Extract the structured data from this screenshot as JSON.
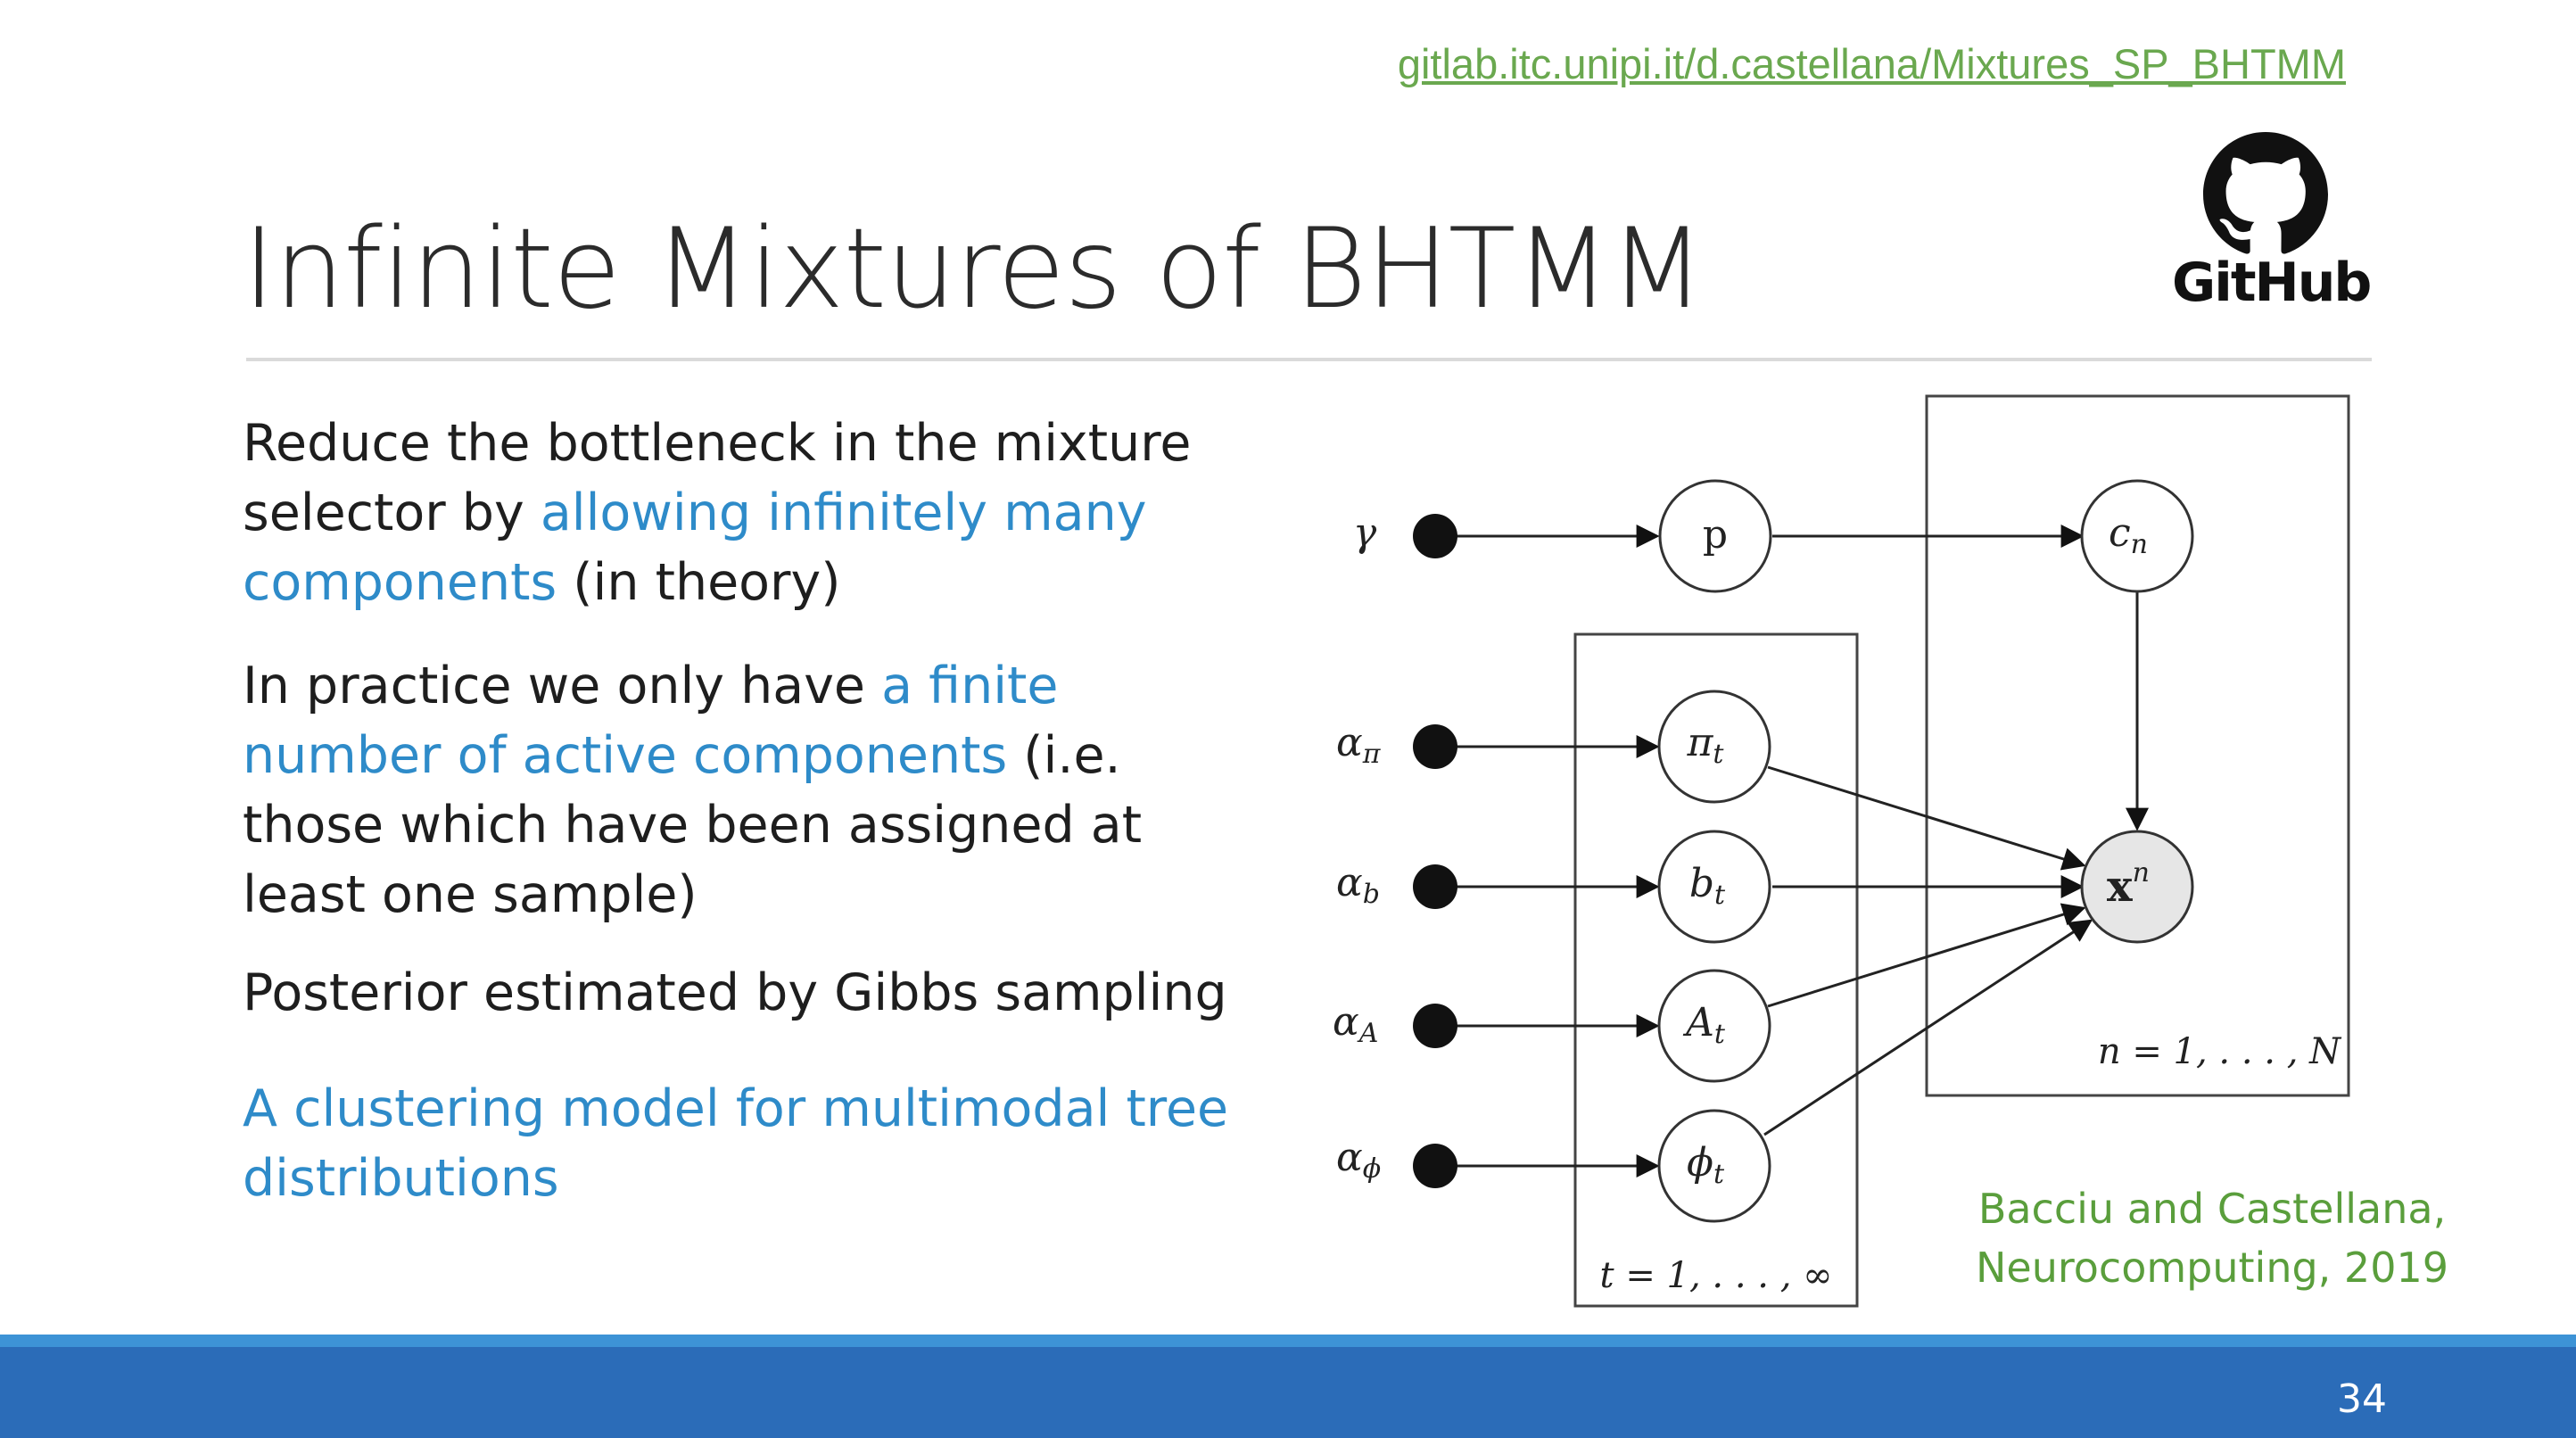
{
  "header": {
    "link": "gitlab.itc.unipi.it/d.castellana/Mixtures_SP_BHTMM",
    "logo_label": "GitHub"
  },
  "title": "Infinite Mixtures of BHTMM",
  "bullets": {
    "b1": {
      "pre": "Reduce the bottleneck in the mixture selector by ",
      "hl": "allowing infinitely many components",
      "post": " (in theory)"
    },
    "b2": {
      "pre": "In practice we only have ",
      "hl": "a finite number of active components",
      "post": " (i.e. those which have been assigned at least one sample)"
    },
    "b3": {
      "text": "Posterior estimated by Gibbs sampling"
    },
    "b4": {
      "hl": "A clustering model for multimodal tree distributions"
    }
  },
  "diagram": {
    "hyperparams": {
      "gamma": "γ",
      "alpha_pi": "α",
      "alpha_pi_sub": "π",
      "alpha_b": "α",
      "alpha_b_sub": "b",
      "alpha_A": "α",
      "alpha_A_sub": "A",
      "alpha_phi": "α",
      "alpha_phi_sub": "ϕ"
    },
    "nodes": {
      "p": "p",
      "c": "c",
      "c_sub": "n",
      "pi": "π",
      "pi_sub": "t",
      "b": "b",
      "b_sub": "t",
      "A": "A",
      "A_sub": "t",
      "phi": "ϕ",
      "phi_sub": "t",
      "x": "x",
      "x_sup": "n"
    },
    "plates": {
      "t": "t = 1, . . . , ∞",
      "n": "n = 1, . . . , N"
    }
  },
  "citation": {
    "line1": "Bacciu and Castellana,",
    "line2": "Neurocomputing, 2019"
  },
  "footer": {
    "page_number": "34"
  }
}
